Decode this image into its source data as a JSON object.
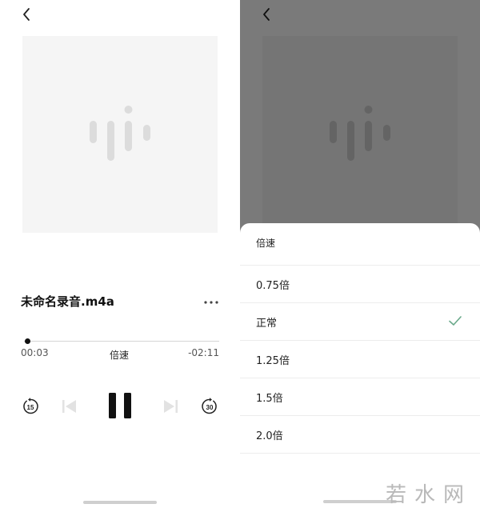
{
  "player": {
    "title": "未命名录音.m4a",
    "elapsed": "00:03",
    "speed_label": "倍速",
    "remaining": "-02:11",
    "progress": 0.02,
    "skip_back_seconds": "15",
    "skip_forward_seconds": "30"
  },
  "speed_sheet": {
    "title": "倍速",
    "options": [
      "0.75倍",
      "正常",
      "1.25倍",
      "1.5倍",
      "2.0倍"
    ],
    "selected": "正常"
  },
  "watermark": "若水网",
  "colors": {
    "art_bg": "#f5f5f5",
    "wave": "#dcdcdc",
    "overlay": "#7a7a7a",
    "check": "#6aa98a",
    "text": "#1a1a1a"
  },
  "icons": [
    "back-chevron-icon",
    "more-dots-icon",
    "skip-back-15-icon",
    "previous-icon",
    "pause-icon",
    "next-icon",
    "skip-forward-30-icon",
    "check-icon",
    "voice-wave-icon"
  ]
}
